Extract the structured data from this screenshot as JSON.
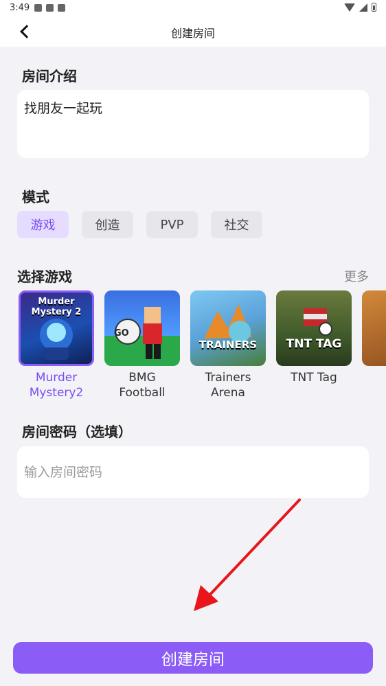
{
  "status_bar": {
    "time": "3:49"
  },
  "header": {
    "title": "创建房间"
  },
  "intro": {
    "heading": "房间介绍",
    "text": "找朋友一起玩"
  },
  "mode": {
    "heading": "模式",
    "options": [
      {
        "label": "游戏",
        "selected": true
      },
      {
        "label": "创造",
        "selected": false
      },
      {
        "label": "PVP",
        "selected": false
      },
      {
        "label": "社交",
        "selected": false
      }
    ]
  },
  "games": {
    "heading": "选择游戏",
    "more_label": "更多",
    "items": [
      {
        "name": "Murder\nMystery2",
        "thumb_text": "Murder Mystery 2",
        "selected": true
      },
      {
        "name": "BMG Football",
        "thumb_text": "GO",
        "selected": false
      },
      {
        "name": "Trainers\nArena",
        "thumb_text": "TRAINERS",
        "selected": false
      },
      {
        "name": "TNT Tag",
        "thumb_text": "TNT TAG",
        "selected": false
      }
    ]
  },
  "password": {
    "heading": "房间密码（选填）",
    "placeholder": "输入房间密码"
  },
  "submit": {
    "label": "创建房间"
  },
  "colors": {
    "accent": "#8b5cf6",
    "annotation_arrow": "#e8161b"
  }
}
